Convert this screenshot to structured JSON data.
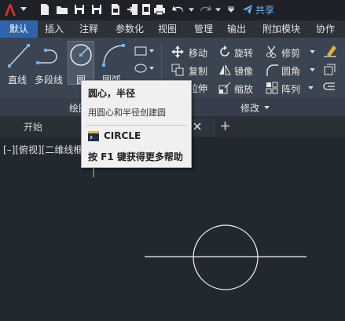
{
  "share_label": "共享",
  "tabs": [
    "默认",
    "插入",
    "注释",
    "参数化",
    "视图",
    "管理",
    "输出",
    "附加模块",
    "协作"
  ],
  "draw_tools": {
    "line": "直线",
    "polyline": "多段线",
    "circle": "圆",
    "arc": "圆弧",
    "panel_title": "绘图"
  },
  "modify_tools": {
    "move": "移动",
    "rotate": "旋转",
    "trim": "修剪",
    "copy": "复制",
    "mirror": "镜像",
    "fillet": "圆角",
    "stretch": "拉伸",
    "scale": "缩放",
    "array": "阵列",
    "panel_title": "修改"
  },
  "doc_tab": "开始",
  "viewport_label": "[–][俯视][二维线框]",
  "tooltip": {
    "title": "圆心，半径",
    "description": "用圆心和半径创建圆",
    "command": "CIRCLE",
    "help": "按 F1 键获得更多帮助"
  },
  "colors": {
    "accent": "#2f63ab",
    "share": "#6fb1ef",
    "canvas": "#212830",
    "ribbon": "#3b4451"
  }
}
